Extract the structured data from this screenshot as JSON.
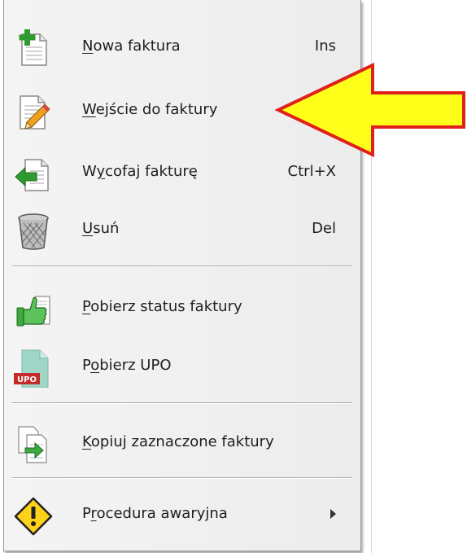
{
  "menu": {
    "items": [
      {
        "pre": "",
        "u": "N",
        "post": "owa faktura",
        "shortcut": "Ins",
        "icon": "new-document-plus-icon"
      },
      {
        "pre": "",
        "u": "W",
        "post": "ejście do faktury",
        "shortcut": "",
        "icon": "document-edit-pencil-icon"
      },
      {
        "pre": "W",
        "u": "y",
        "post": "cofaj fakturę",
        "shortcut": "Ctrl+X",
        "icon": "document-withdraw-arrow-icon"
      },
      {
        "pre": "",
        "u": "U",
        "post": "suń",
        "shortcut": "Del",
        "icon": "trash-bin-icon"
      },
      {
        "pre": "",
        "u": "P",
        "post": "obierz status faktury",
        "shortcut": "",
        "icon": "thumbs-up-document-icon"
      },
      {
        "pre": "P",
        "u": "o",
        "post": "bierz UPO",
        "shortcut": "",
        "icon": "upo-document-icon"
      },
      {
        "pre": "",
        "u": "K",
        "post": "opiuj zaznaczone faktury",
        "shortcut": "",
        "icon": "copy-documents-arrow-icon"
      },
      {
        "pre": "P",
        "u": "r",
        "post": "ocedura awaryjna",
        "shortcut": "",
        "icon": "warning-diamond-icon"
      }
    ],
    "upo_badge": "UPO"
  },
  "colors": {
    "menu_bg": "#efefef",
    "separator": "#a9a9a9",
    "highlight_arrow_fill": "#ffff1a",
    "highlight_arrow_stroke": "#e0201a"
  }
}
